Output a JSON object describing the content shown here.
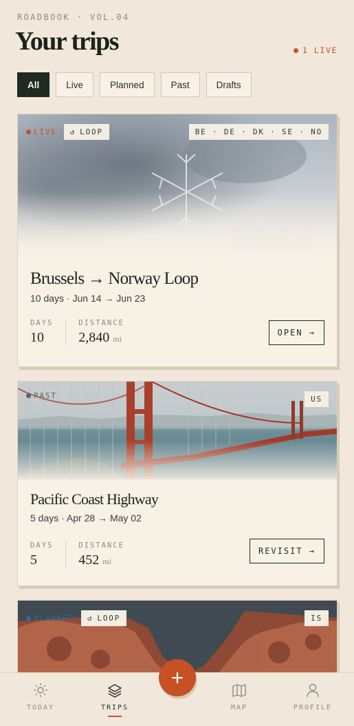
{
  "header": {
    "eyebrow": "ROADBOOK · VOL.04",
    "title": "Your trips",
    "live_count": "1 LIVE"
  },
  "filters": [
    "All",
    "Live",
    "Planned",
    "Past",
    "Drafts"
  ],
  "active_filter": "All",
  "trips": [
    {
      "status": "LIVE",
      "tag": "LOOP",
      "countries": "BE · DE · DK · SE · NO",
      "image": "snowflake",
      "title": "Brussels → Norway Loop",
      "dates": "10 days · Jun 14 → Jun 23",
      "days_label": "DAYS",
      "days": "10",
      "distance_label": "DISTANCE",
      "distance": "2,840",
      "distance_unit": "mi",
      "action": "OPEN →"
    },
    {
      "status": "PAST",
      "countries": "US",
      "image": "golden-gate-bridge",
      "title": "Pacific Coast Highway",
      "dates": "5 days · Apr 28 → May 02",
      "days_label": "DAYS",
      "days": "5",
      "distance_label": "DISTANCE",
      "distance": "452",
      "distance_unit": "mi",
      "action": "REVISIT →"
    },
    {
      "status": "PLANNED",
      "tag": "LOOP",
      "countries": "IS",
      "image": "red-canyon"
    }
  ],
  "tabbar": {
    "items": [
      {
        "label": "TODAY",
        "icon": "sun-icon"
      },
      {
        "label": "TRIPS",
        "icon": "layers-icon"
      },
      {
        "label": "MAP",
        "icon": "map-icon"
      },
      {
        "label": "PROFILE",
        "icon": "user-icon"
      }
    ],
    "active": "TRIPS",
    "fab_icon": "plus-icon"
  },
  "colors": {
    "background": "#f1e8db",
    "accent": "#c4532b",
    "dark": "#1e2a22"
  }
}
